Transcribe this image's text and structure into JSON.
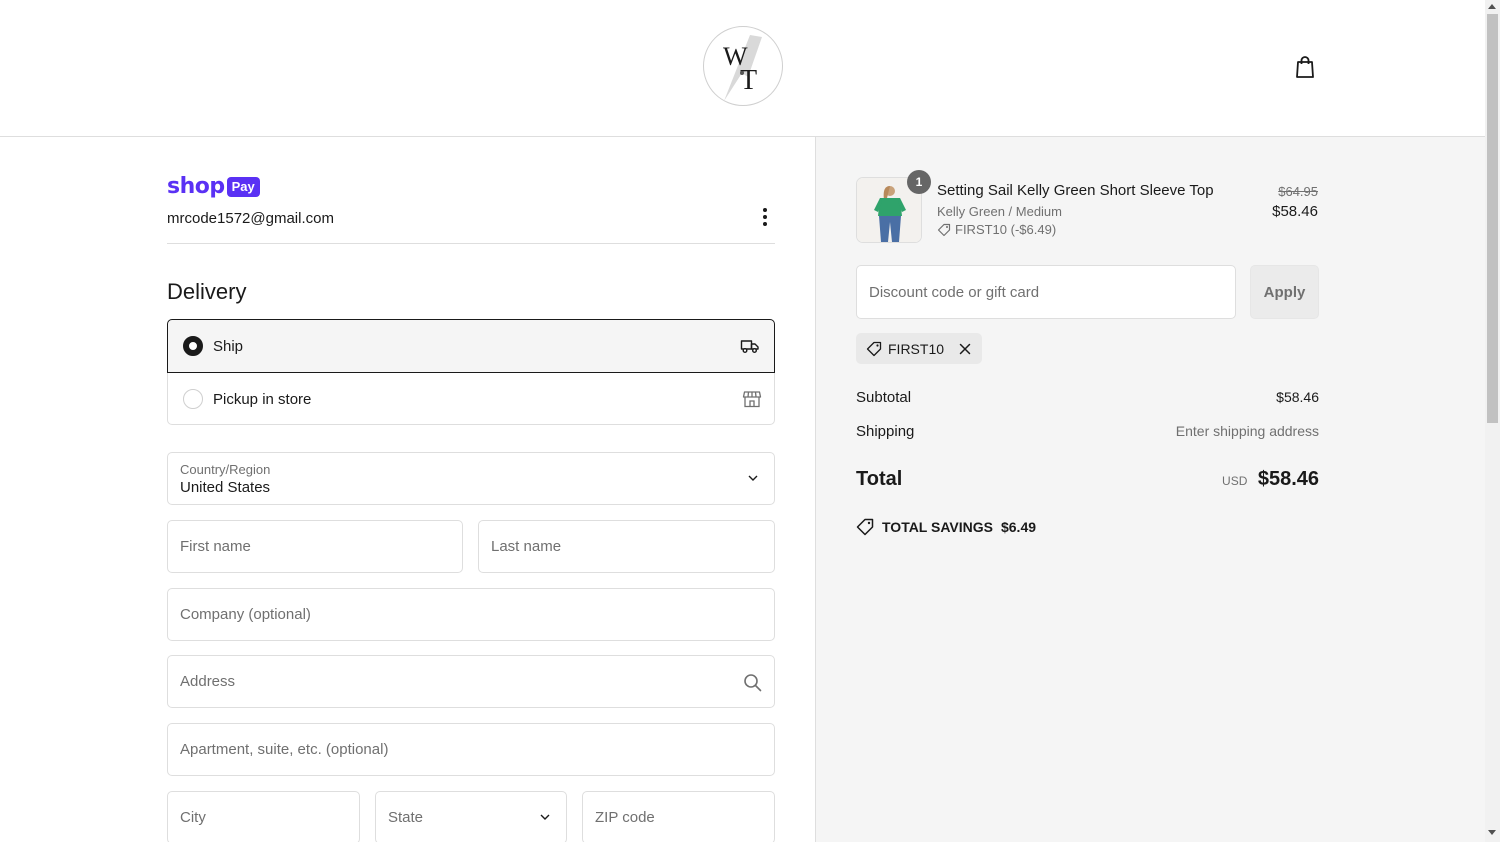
{
  "store": {
    "logo_text": "WT"
  },
  "express": {
    "shop_text": "shop",
    "pay_text": "Pay",
    "account_email": "mrcode1572@gmail.com"
  },
  "delivery": {
    "title": "Delivery",
    "options": [
      {
        "label": "Ship",
        "selected": true,
        "icon": "truck-icon"
      },
      {
        "label": "Pickup in store",
        "selected": false,
        "icon": "store-icon"
      }
    ]
  },
  "form": {
    "country_label": "Country/Region",
    "country_value": "United States",
    "first_name_placeholder": "First name",
    "last_name_placeholder": "Last name",
    "company_placeholder": "Company (optional)",
    "address_placeholder": "Address",
    "apartment_placeholder": "Apartment, suite, etc. (optional)",
    "city_placeholder": "City",
    "state_value": "State",
    "zip_placeholder": "ZIP code"
  },
  "summary": {
    "product": {
      "quantity": "1",
      "title": "Setting Sail Kelly Green Short Sleeve Top",
      "variant": "Kelly Green / Medium",
      "discount": "FIRST10 (-$6.49)",
      "original_price": "$64.95",
      "price": "$58.46"
    },
    "discount_placeholder": "Discount code or gift card",
    "apply_label": "Apply",
    "applied_code": "FIRST10",
    "subtotal_label": "Subtotal",
    "subtotal_value": "$58.46",
    "shipping_label": "Shipping",
    "shipping_value": "Enter shipping address",
    "total_label": "Total",
    "total_currency": "USD",
    "total_value": "$58.46",
    "savings_label": "TOTAL SAVINGS",
    "savings_value": "$6.49"
  },
  "colors": {
    "shop_pay_purple": "#5a31f4",
    "summary_bg": "#f5f5f5",
    "border": "#dedede"
  }
}
